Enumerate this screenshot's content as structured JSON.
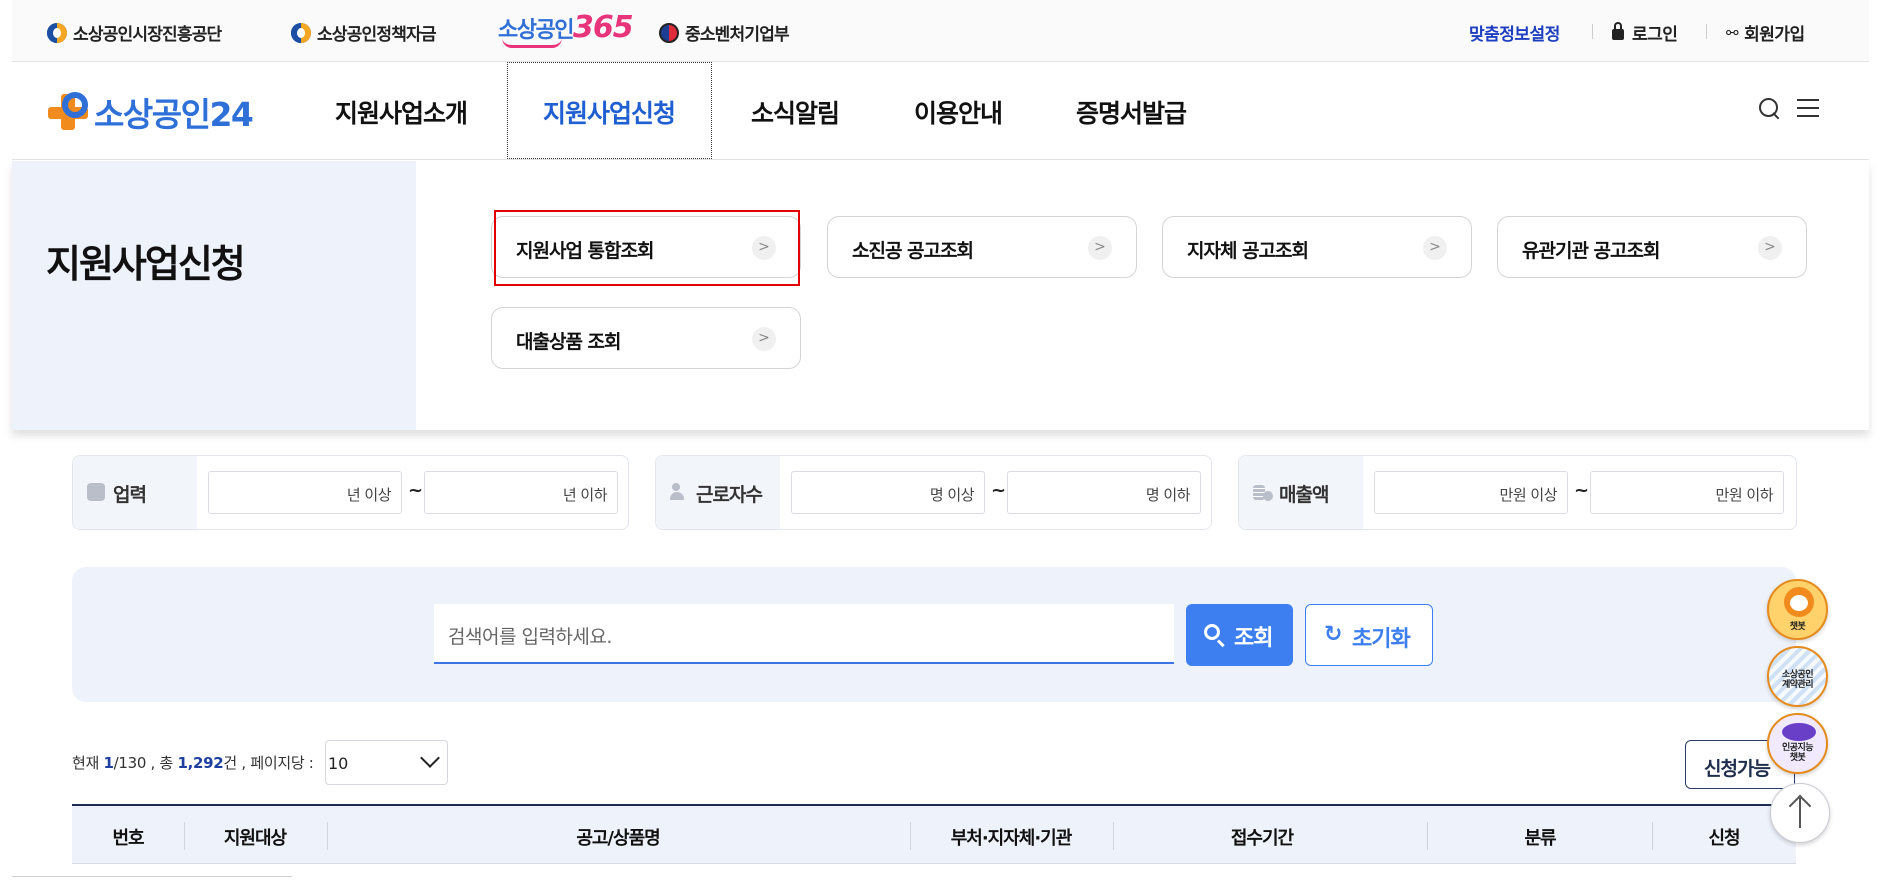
{
  "topbar": {
    "family_sites": [
      {
        "label": "소상공인시장진흥공단",
        "icon": "agency-emblem-icon"
      },
      {
        "label": "소상공인정책자금",
        "icon": "agency-emblem-icon"
      },
      {
        "label": "중소벤처기업부",
        "icon": "taegeuk-emblem-icon"
      }
    ],
    "logo_365": {
      "text": "소상공인",
      "number": "365"
    },
    "custom_info": "맞춤정보설정",
    "login": "로그인",
    "signup": "회원가입"
  },
  "nav": {
    "brand": "소상공인24",
    "menu": [
      {
        "label": "지원사업소개",
        "active": false
      },
      {
        "label": "지원사업신청",
        "active": true
      },
      {
        "label": "소식알림",
        "active": false
      },
      {
        "label": "이용안내",
        "active": false
      },
      {
        "label": "증명서발급",
        "active": false
      }
    ],
    "icons": [
      "search-icon",
      "menu-icon"
    ]
  },
  "submenu": {
    "title": "지원사업신청",
    "items": [
      {
        "label": "지원사업 통합조회",
        "highlighted": true
      },
      {
        "label": "소진공 공고조회",
        "highlighted": false
      },
      {
        "label": "지자체 공고조회",
        "highlighted": false
      },
      {
        "label": "유관기관 공고조회",
        "highlighted": false
      },
      {
        "label": "대출상품 조회",
        "highlighted": false
      }
    ],
    "chevron": ">"
  },
  "filters": [
    {
      "label": "업력",
      "icon": "business-icon",
      "from_placeholder": "년 이상",
      "to_placeholder": "년 이하"
    },
    {
      "label": "근로자수",
      "icon": "people-icon",
      "from_placeholder": "명 이상",
      "to_placeholder": "명 이하"
    },
    {
      "label": "매출액",
      "icon": "coin-icon",
      "from_placeholder": "만원 이상",
      "to_placeholder": "만원 이하"
    }
  ],
  "range_separator": "~",
  "search": {
    "placeholder": "검색어를 입력하세요.",
    "search_button": "조회",
    "reset_button": "초기화"
  },
  "results": {
    "prefix_current": "현재 ",
    "current_page": "1",
    "total_pages": "/130 , 총 ",
    "total_count": "1,292",
    "suffix": "건 , 페이지당 : ",
    "per_page": "10",
    "applyable_button": "신청가능"
  },
  "table": {
    "headers": [
      "번호",
      "지원대상",
      "공고/상품명",
      "부처·지자체·기관",
      "접수기간",
      "분류",
      "신청"
    ]
  },
  "floating": {
    "chatbot": "챗봇",
    "contract": "소상공인\n계약관리",
    "ai_chatbot": "인공지능\n챗봇"
  },
  "colors": {
    "brand_blue": "#2e6fd8",
    "brand_orange": "#f28b1e",
    "accent_button": "#3d7ff0",
    "highlight_border": "#e00000",
    "nav_active": "#1f5fd1"
  }
}
